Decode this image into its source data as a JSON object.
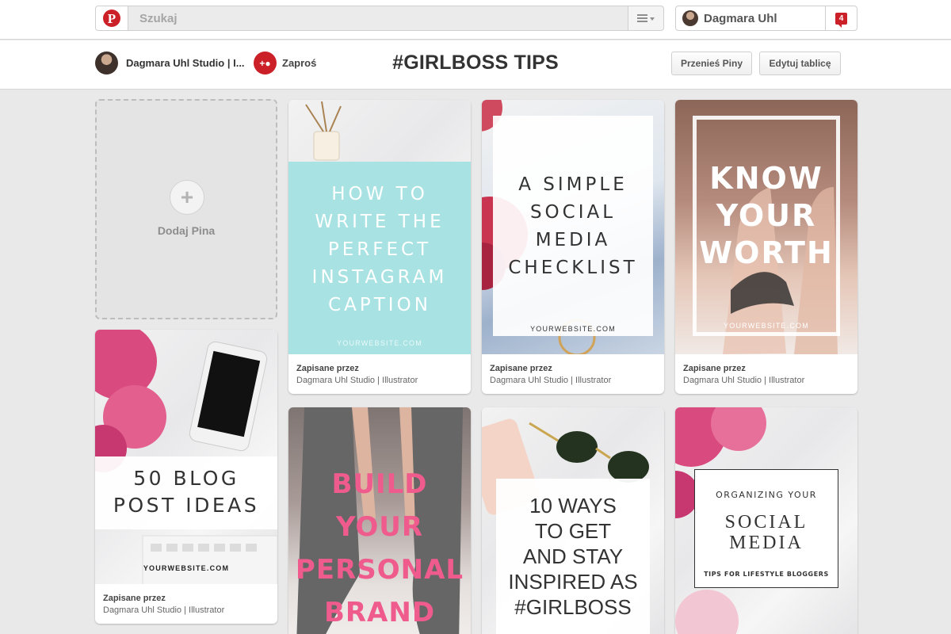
{
  "topbar": {
    "search_placeholder": "Szukaj",
    "user_name": "Dagmara Uhl",
    "notifications_count": "4"
  },
  "board": {
    "owner_name": "Dagmara Uhl Studio | I...",
    "invite_label": "Zaproś",
    "title": "#GIRLBOSS TIPS",
    "move_pins_label": "Przenieś Piny",
    "edit_board_label": "Edytuj tablicę"
  },
  "add_pin": {
    "label": "Dodaj Pina",
    "icon": "plus-icon"
  },
  "pins": [
    {
      "lines": [
        "HOW TO",
        "WRITE THE",
        "PERFECT",
        "INSTAGRAM",
        "CAPTION"
      ],
      "site": "YOURWEBSITE.COM",
      "saved_by_label": "Zapisane przez",
      "saved_by": "Dagmara Uhl Studio | Illustrator"
    },
    {
      "lines": [
        "A SIMPLE",
        "SOCIAL",
        "MEDIA",
        "CHECKLIST"
      ],
      "site": "YOURWEBSITE.COM",
      "saved_by_label": "Zapisane przez",
      "saved_by": "Dagmara Uhl Studio | Illustrator"
    },
    {
      "lines": [
        "KNOW",
        "YOUR",
        "WORTH"
      ],
      "site": "YOURWEBSITE.COM",
      "saved_by_label": "Zapisane przez",
      "saved_by": "Dagmara Uhl Studio | Illustrator"
    },
    {
      "lines": [
        "50 BLOG",
        "POST IDEAS"
      ],
      "site": "YOURWEBSITE.COM",
      "saved_by_label": "Zapisane przez",
      "saved_by": "Dagmara Uhl Studio | Illustrator"
    },
    {
      "lines": [
        "BUILD YOUR",
        "PERSONAL",
        "BRAND"
      ]
    },
    {
      "lines": [
        "10 WAYS",
        "TO GET",
        "AND STAY",
        "INSPIRED AS",
        "#GIRLBOSS"
      ]
    },
    {
      "lines": [
        "ORGANIZING YOUR",
        "SOCIAL",
        "MEDIA",
        "TIPS FOR LIFESTYLE BLOGGERS"
      ]
    }
  ],
  "colors": {
    "brand_red": "#cb2027",
    "background": "#e9e9e9",
    "turquoise": "#a8e2e2",
    "pink_text": "#ef5b8c"
  }
}
